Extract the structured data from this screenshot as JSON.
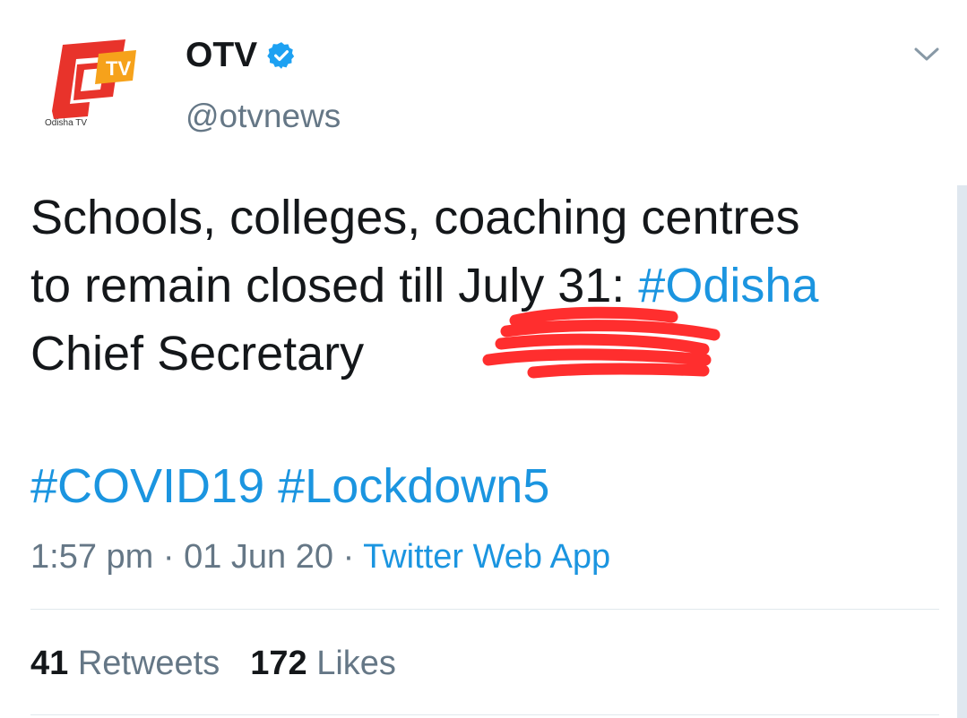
{
  "account": {
    "display_name": "OTV",
    "handle": "@otvnews",
    "avatar_label": "Odisha TV",
    "avatar_logo_text": "TV",
    "verified": true
  },
  "tweet": {
    "line1": "Schools, colleges, coaching centres",
    "line2_text": "to remain closed till July 31: ",
    "line2_hashtag": "#Odisha",
    "line3": "Chief Secretary",
    "hashtag1": "#COVID19",
    "hashtag2": "#Lockdown5"
  },
  "meta": {
    "time": "1:57 pm",
    "sep1": " · ",
    "date": "01 Jun 20",
    "sep2": " · ",
    "source": "Twitter Web App"
  },
  "stats": {
    "retweets_count": "41",
    "retweets_label": " Retweets",
    "likes_count": "172",
    "likes_label": " Likes"
  },
  "colors": {
    "link": "#1b95e0",
    "text": "#14171a",
    "secondary": "#657786",
    "scribble": "#ff2e2e"
  },
  "icons": {
    "verified": "verified-badge-icon",
    "menu": "chevron-down-icon"
  }
}
